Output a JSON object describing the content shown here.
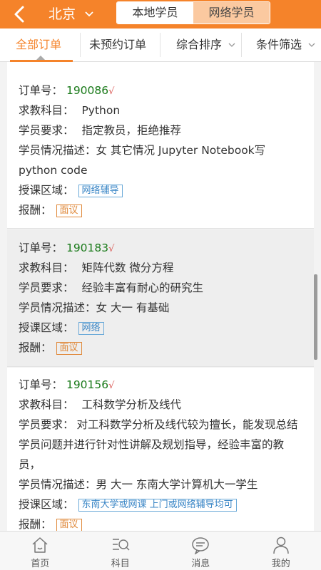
{
  "header": {
    "city": "北京",
    "tabs": [
      {
        "label": "本地学员",
        "active": true
      },
      {
        "label": "网络学员",
        "active": false
      }
    ],
    "accent_color": "#f5832a"
  },
  "filters": {
    "items": [
      {
        "label": "全部订单",
        "active": true
      },
      {
        "label": "未预约订单",
        "active": false
      },
      {
        "label": "综合排序",
        "active": false
      },
      {
        "label": "条件筛选",
        "active": false
      }
    ]
  },
  "labels": {
    "order_no": "订单号：",
    "subject": "求教科目：",
    "requirement": "学员要求：",
    "description": "学员情况描述：",
    "area": "授课区域：",
    "pay": "报酬：",
    "check": "√"
  },
  "orders": [
    {
      "order_no": "190086",
      "subject": "Python",
      "requirement": "指定教员，拒绝推荐",
      "description": "女 其它情况 Jupyter Notebook写python code",
      "area": "网络辅导",
      "pay": "面议"
    },
    {
      "order_no": "190183",
      "subject": "矩阵代数 微分方程",
      "requirement": "经验丰富有耐心的研究生",
      "description": "女 大一 有基础",
      "area": "网络",
      "pay": "面议"
    },
    {
      "order_no": "190156",
      "subject": "工科数学分析及线代",
      "requirement": "对工科数学分析及线代较为擅长，能发现总结学员问题并进行针对性讲解及规划指导，经验丰富的教员，",
      "description": "男 大一 东南大学计算机大一学生",
      "area": "东南大学或网课 上门或网络辅导均可",
      "pay": "面议"
    }
  ],
  "bottom_nav": [
    {
      "label": "首页",
      "icon": "home-icon"
    },
    {
      "label": "科目",
      "icon": "subject-search-icon"
    },
    {
      "label": "消息",
      "icon": "message-icon"
    },
    {
      "label": "我的",
      "icon": "user-icon"
    }
  ]
}
